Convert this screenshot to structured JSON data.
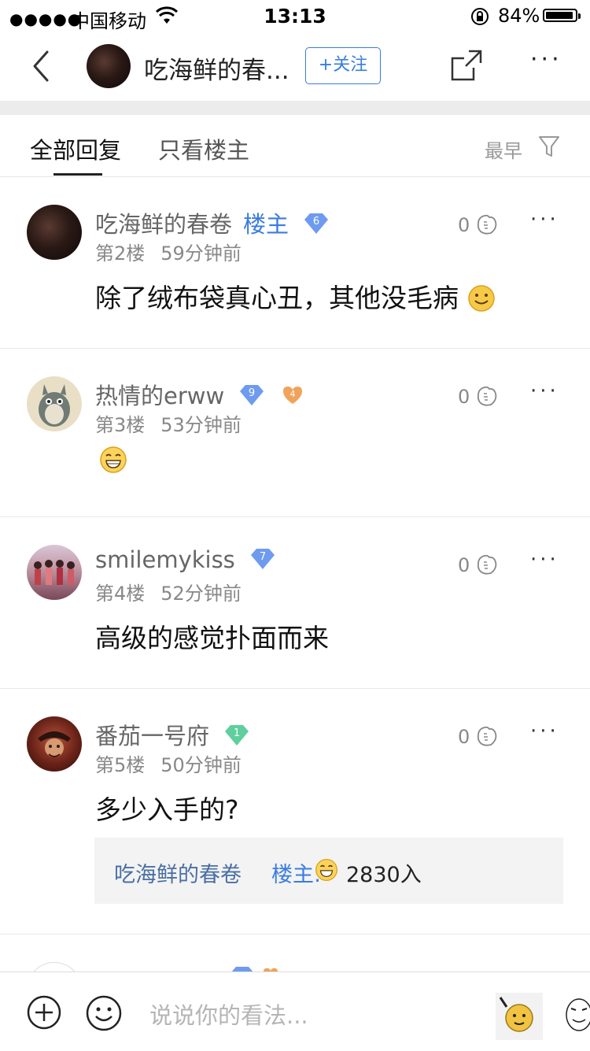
{
  "status_bar": {
    "carrier": "中国移动",
    "time": "13:13",
    "battery": "84%",
    "battery_level": 0.84
  },
  "nav": {
    "title": "吃海鲜的春...",
    "follow_label": "+关注"
  },
  "tabs": {
    "all": "全部回复",
    "owner_only": "只看楼主",
    "sort": "最早"
  },
  "posts": [
    {
      "username": "吃海鲜的春卷",
      "owner_tag": "楼主",
      "level": "6",
      "floor": "第2楼",
      "time": "59分钟前",
      "likes": "0",
      "content": "除了绒布袋真心丑，其他没毛病"
    },
    {
      "username": "热情的erww",
      "level": "9",
      "badge": "4",
      "floor": "第3楼",
      "time": "53分钟前",
      "likes": "0",
      "content": ""
    },
    {
      "username": "smilemykiss",
      "level": "7",
      "floor": "第4楼",
      "time": "52分钟前",
      "likes": "0",
      "content": "高级的感觉扑面而来"
    },
    {
      "username": "番茄一号府",
      "level": "1",
      "floor": "第5楼",
      "time": "50分钟前",
      "likes": "0",
      "content": "多少入手的?",
      "reply": {
        "name": "吃海鲜的春卷",
        "tag": "楼主:",
        "text": "2830入"
      }
    }
  ],
  "bottom": {
    "placeholder": "说说你的看法..."
  },
  "colors": {
    "accent": "#3a7ce0",
    "level_blue": "#6e9bf0",
    "level_green": "#5fcf9e"
  }
}
